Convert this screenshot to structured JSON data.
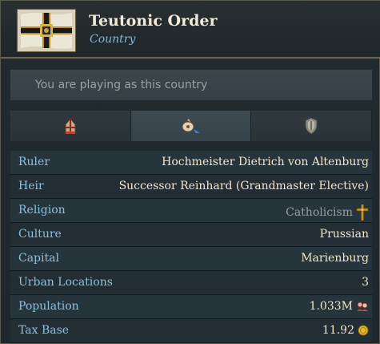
{
  "header": {
    "title": "Teutonic Order",
    "subtitle": "Country",
    "flag_icon": "teutonic-cross-flag"
  },
  "notice": {
    "text": "You are playing as this country"
  },
  "tabs": [
    {
      "name": "tab-ruler",
      "icon": "bishop-mitre-icon",
      "active": false
    },
    {
      "name": "tab-overview",
      "icon": "quill-pointer-icon",
      "active": true
    },
    {
      "name": "tab-military",
      "icon": "shield-icon",
      "active": false
    }
  ],
  "rows": [
    {
      "label": "Ruler",
      "value": "Hochmeister Dietrich von Altenburg"
    },
    {
      "label": "Heir",
      "value": "Successor Reinhard (Grandmaster Elective)"
    },
    {
      "label": "Religion",
      "value": "Catholicism",
      "icon": "crucifix-icon"
    },
    {
      "label": "Culture",
      "value": "Prussian"
    },
    {
      "label": "Capital",
      "value": "Marienburg"
    },
    {
      "label": "Urban Locations",
      "value": "3"
    },
    {
      "label": "Population",
      "value": "1.033M",
      "icon": "population-icon"
    },
    {
      "label": "Tax Base",
      "value": "11.92",
      "icon": "gold-coin-icon"
    }
  ],
  "colors": {
    "label": "#8cc0df",
    "value": "#f2e6c8",
    "subtitle": "#86b7d6",
    "border": "#6b6650"
  }
}
